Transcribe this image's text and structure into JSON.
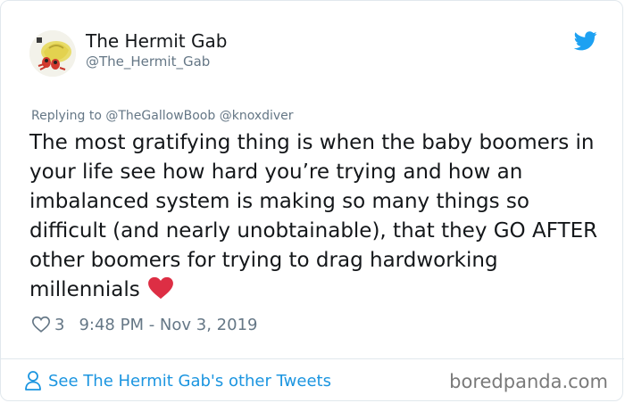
{
  "tweet": {
    "author_name": "The Hermit Gab",
    "author_handle": "@The_Hermit_Gab",
    "reply_to": "Replying to @TheGallowBoob @knoxdiver",
    "text": "The most gratifying thing is when the baby boomers in your life see how hard you’re trying and how an imbalanced system is making so many things so difficult (and nearly unobtainable), that they GO AFTER other boomers for trying to drag hardworking millennials",
    "like_count": "3",
    "timestamp": "9:48 PM - Nov 3, 2019"
  },
  "footer": {
    "link_label": "See The Hermit Gab's other Tweets"
  },
  "watermark": "boredpanda.com",
  "colors": {
    "twitter_blue": "#1da1f2",
    "link_blue": "#1b95e0",
    "meta_gray": "#657786",
    "heart_red": "#dd2e44"
  },
  "icons": [
    "avatar-hermit-crab",
    "twitter-bird-icon",
    "heart-emoji",
    "like-heart-icon",
    "person-icon"
  ]
}
